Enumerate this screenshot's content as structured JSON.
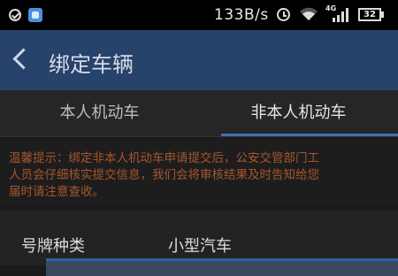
{
  "status_bar": {
    "net_speed": "133B/s",
    "network_type": "4G",
    "battery": "32",
    "icons": [
      "check-circle-icon",
      "app-icon",
      "alarm-icon",
      "wifi-icon",
      "signal-icon",
      "battery-icon"
    ]
  },
  "header": {
    "title": "绑定车辆",
    "back_icon": "chevron-left-icon",
    "background": "#27426b"
  },
  "tabs": [
    {
      "label": "本人机动车",
      "selected": false
    },
    {
      "label": "非本人机动车",
      "selected": true
    }
  ],
  "notice": {
    "text": "温馨提示：绑定非本人机动车申请提交后，公安交管部门工\n人员会仔细核实提交信息，我们会将审核结果及时告知给您\n届时请注意查收。",
    "color": "#a5572c"
  },
  "form": {
    "plate_type_label": "号牌种类",
    "plate_type_value": "小型汽车"
  },
  "accent_color": "#3f6fb3"
}
